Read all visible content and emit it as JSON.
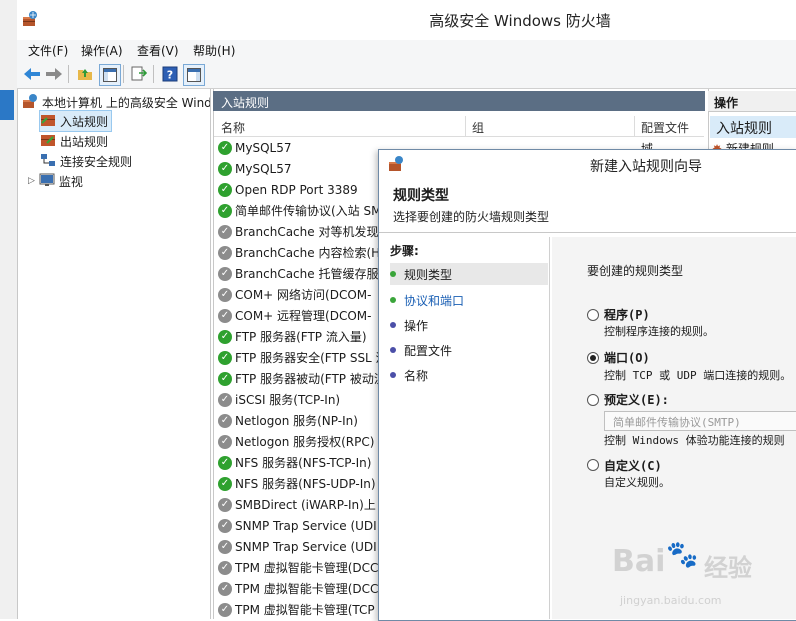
{
  "window": {
    "title": "高级安全 Windows 防火墙"
  },
  "menu": [
    "文件(F)",
    "操作(A)",
    "查看(V)",
    "帮助(H)"
  ],
  "tree": {
    "root": "本地计算机 上的高级安全 Wind",
    "items": [
      "入站规则",
      "出站规则",
      "连接安全规则",
      "监视"
    ]
  },
  "center": {
    "header": "入站规则",
    "columns": [
      "名称",
      "组",
      "配置文件"
    ],
    "first_row_profile": "域",
    "rules": [
      {
        "name": "MySQL57",
        "enabled": true
      },
      {
        "name": "MySQL57",
        "enabled": true
      },
      {
        "name": "Open RDP Port 3389",
        "enabled": true
      },
      {
        "name": "简单邮件传输协议(入站 SM",
        "enabled": true
      },
      {
        "name": "BranchCache 对等机发现",
        "enabled": false
      },
      {
        "name": "BranchCache 内容检索(H",
        "enabled": false
      },
      {
        "name": "BranchCache 托管缓存服",
        "enabled": false
      },
      {
        "name": "COM+ 网络访问(DCOM-",
        "enabled": false
      },
      {
        "name": "COM+ 远程管理(DCOM-",
        "enabled": false
      },
      {
        "name": "FTP 服务器(FTP 流入量)",
        "enabled": true
      },
      {
        "name": "FTP 服务器安全(FTP SSL 流",
        "enabled": true
      },
      {
        "name": "FTP 服务器被动(FTP 被动流",
        "enabled": true
      },
      {
        "name": "iSCSI 服务(TCP-In)",
        "enabled": false
      },
      {
        "name": "Netlogon 服务(NP-In)",
        "enabled": false
      },
      {
        "name": "Netlogon 服务授权(RPC)",
        "enabled": false
      },
      {
        "name": "NFS 服务器(NFS-TCP-In)",
        "enabled": true
      },
      {
        "name": "NFS 服务器(NFS-UDP-In)",
        "enabled": true
      },
      {
        "name": "SMBDirect (iWARP-In)上",
        "enabled": false
      },
      {
        "name": "SNMP Trap Service (UDI",
        "enabled": false
      },
      {
        "name": "SNMP Trap Service (UDI",
        "enabled": false
      },
      {
        "name": "TPM 虚拟智能卡管理(DCC",
        "enabled": false
      },
      {
        "name": "TPM 虚拟智能卡管理(DCC",
        "enabled": false
      },
      {
        "name": "TPM 虚拟智能卡管理(TCP",
        "enabled": false
      }
    ]
  },
  "actions": {
    "header": "操作",
    "selected": "入站规则",
    "new_rule": "新建规则"
  },
  "wizard": {
    "title": "新建入站规则向导",
    "heading": "规则类型",
    "subheading": "选择要创建的防火墙规则类型",
    "steps_label": "步骤:",
    "steps": [
      "规则类型",
      "协议和端口",
      "操作",
      "配置文件",
      "名称"
    ],
    "prompt": "要创建的规则类型",
    "options": [
      {
        "label": "程序(P)",
        "desc": "控制程序连接的规则。",
        "selected": false
      },
      {
        "label": "端口(O)",
        "desc": "控制 TCP 或 UDP 端口连接的规则。",
        "selected": true
      },
      {
        "label": "预定义(E):",
        "desc": "控制 Windows 体验功能连接的规则",
        "selected": false
      },
      {
        "label": "自定义(C)",
        "desc": "自定义规则。",
        "selected": false
      }
    ],
    "predefined_value": "简单邮件传输协议(SMTP)"
  },
  "watermark": {
    "brand": "Bai",
    "brand2": "经验",
    "url": "jingyan.baidu.com"
  }
}
